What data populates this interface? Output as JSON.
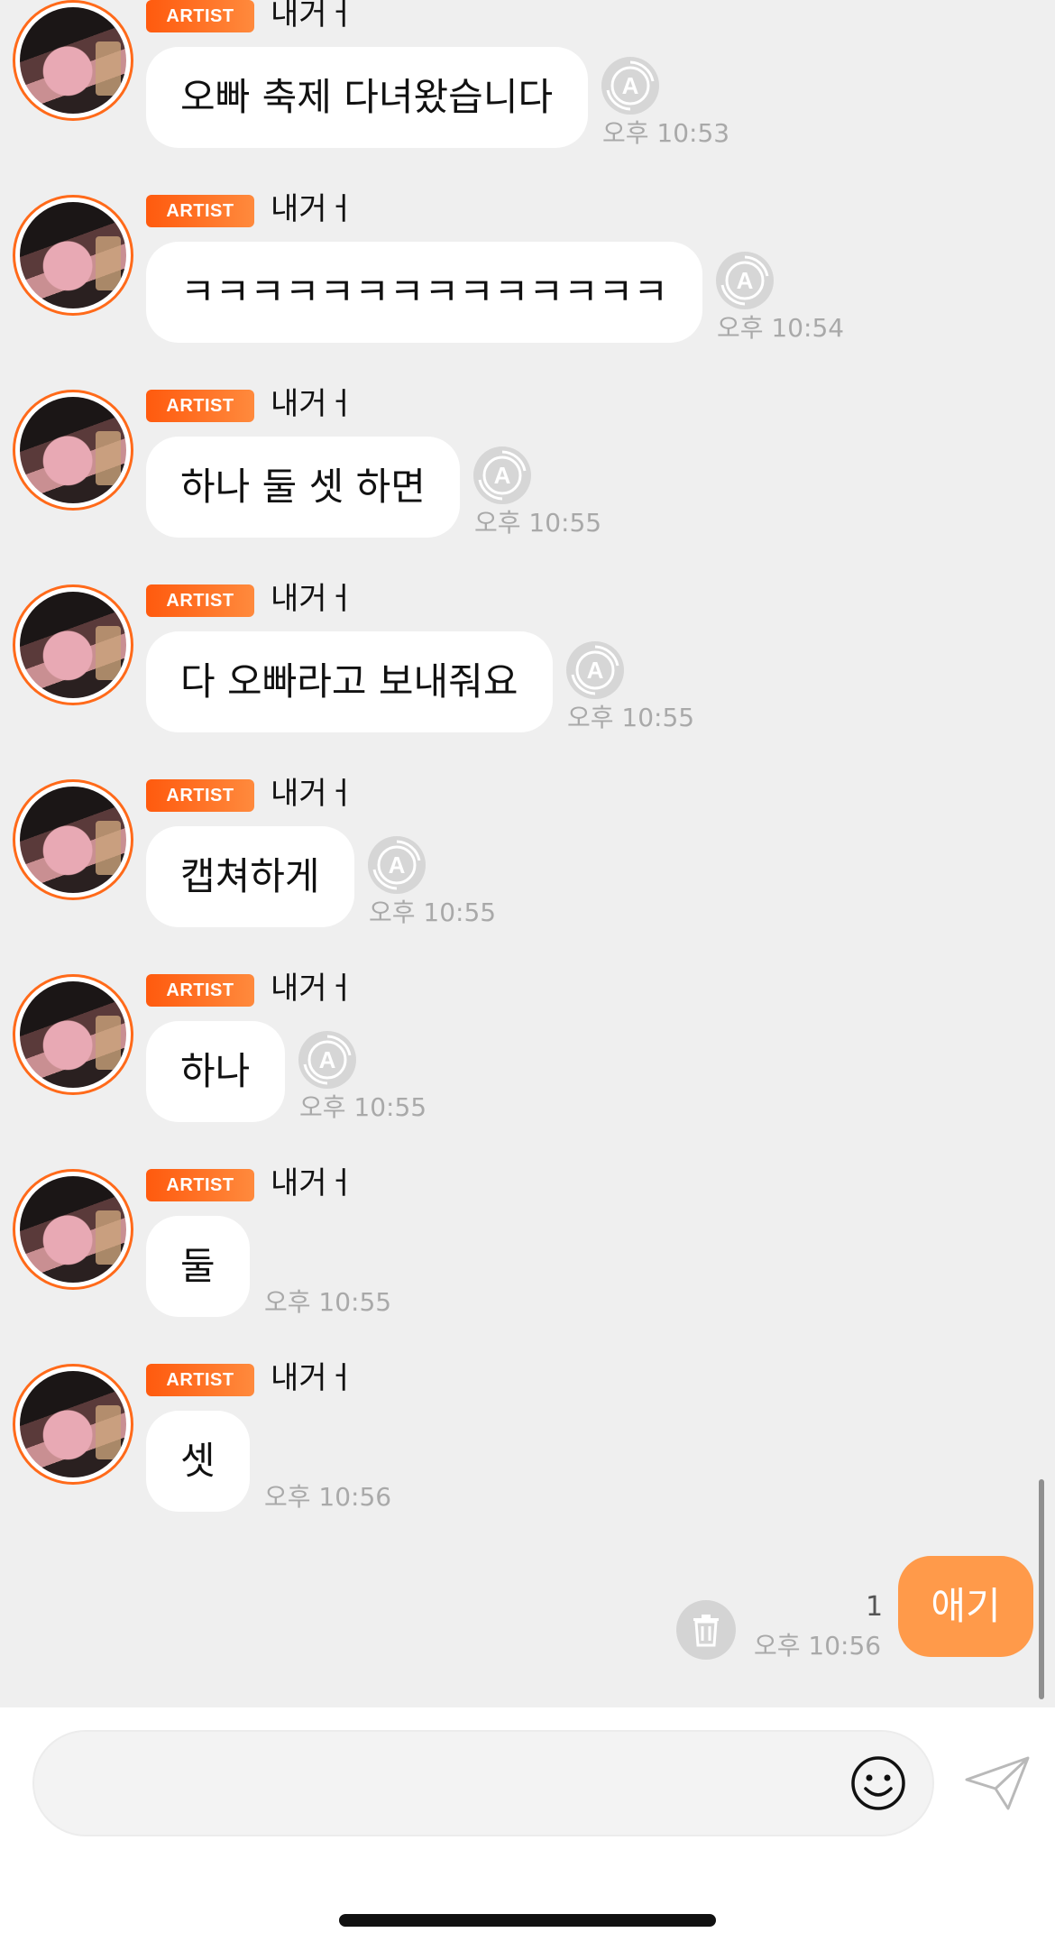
{
  "messages": [
    {
      "badge": "ARTIST",
      "name": "내거ㅓ",
      "text": "오빠 축제 다녀왔습니다",
      "time": "오후 10:53",
      "translate": true
    },
    {
      "badge": "ARTIST",
      "name": "내거ㅓ",
      "text": "ㅋㅋㅋㅋㅋㅋㅋㅋㅋㅋㅋㅋㅋㅋ",
      "time": "오후 10:54",
      "translate": true
    },
    {
      "badge": "ARTIST",
      "name": "내거ㅓ",
      "text": "하나 둘 셋 하면",
      "time": "오후 10:55",
      "translate": true
    },
    {
      "badge": "ARTIST",
      "name": "내거ㅓ",
      "text": "다 오빠라고 보내줘요",
      "time": "오후 10:55",
      "translate": true
    },
    {
      "badge": "ARTIST",
      "name": "내거ㅓ",
      "text": "캡쳐하게",
      "time": "오후 10:55",
      "translate": true
    },
    {
      "badge": "ARTIST",
      "name": "내거ㅓ",
      "text": "하나",
      "time": "오후 10:55",
      "translate": true
    },
    {
      "badge": "ARTIST",
      "name": "내거ㅓ",
      "text": "둘",
      "time": "오후 10:55",
      "translate": false
    },
    {
      "badge": "ARTIST",
      "name": "내거ㅓ",
      "text": "셋",
      "time": "오후 10:56",
      "translate": false
    }
  ],
  "outgoing": {
    "text": "애기",
    "unread": "1",
    "time": "오후 10:56"
  },
  "composer": {
    "placeholder": ""
  },
  "colors": {
    "accent": "#ff6a1a",
    "outgoing_bubble": "#ff9a4a",
    "background": "#efefef"
  },
  "icons": {
    "translate": "translate-a-icon",
    "delete": "trash-icon",
    "emoji": "smiley-icon",
    "send": "paper-plane-icon"
  }
}
